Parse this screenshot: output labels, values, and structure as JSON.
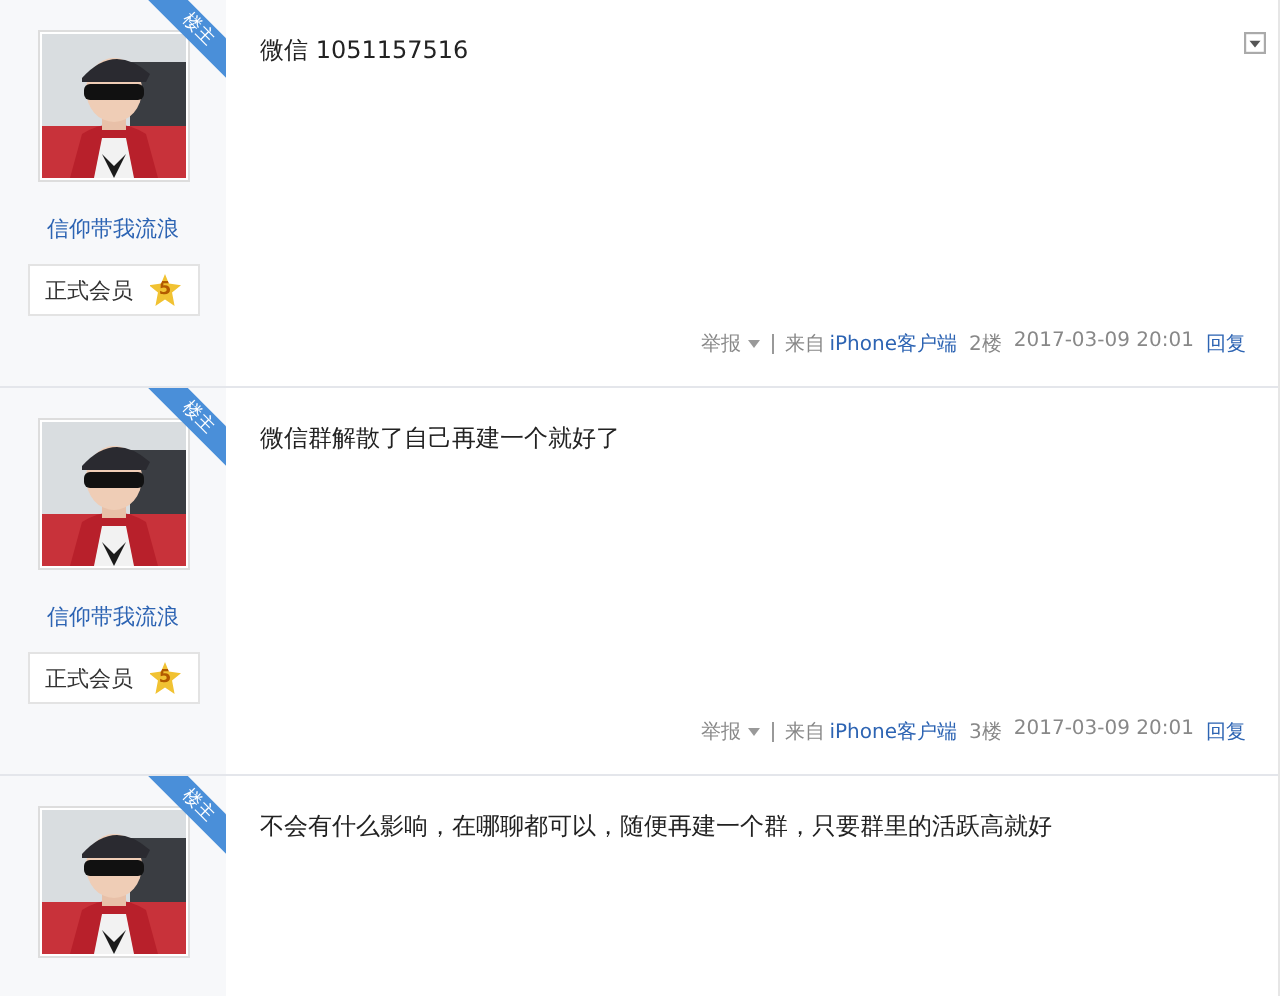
{
  "posts": [
    {
      "op_badge": "楼主",
      "username": "信仰带我流浪",
      "rank": "正式会员",
      "rank_level": "5",
      "content": "微信 1051157516",
      "menu": true,
      "footer": {
        "report": "举报",
        "source_prefix": "来自",
        "source": "iPhone客户端",
        "floor": "2楼",
        "time": "2017-03-09 20:01",
        "reply": "回复"
      }
    },
    {
      "op_badge": "楼主",
      "username": "信仰带我流浪",
      "rank": "正式会员",
      "rank_level": "5",
      "content": "微信群解散了自己再建一个就好了",
      "menu": false,
      "footer": {
        "report": "举报",
        "source_prefix": "来自",
        "source": "iPhone客户端",
        "floor": "3楼",
        "time": "2017-03-09 20:01",
        "reply": "回复"
      }
    },
    {
      "op_badge": "楼主",
      "content": "不会有什么影响，在哪聊都可以，随便再建一个群，只要群里的活跃高就好",
      "menu": false
    }
  ]
}
